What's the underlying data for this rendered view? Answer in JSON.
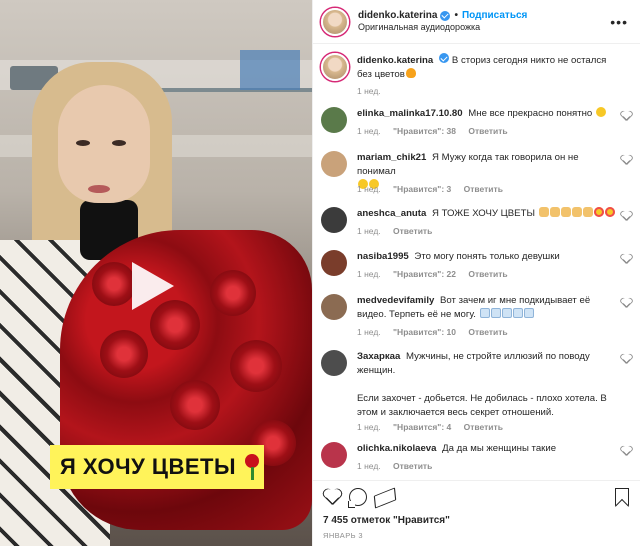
{
  "video": {
    "caption": "Я ХОЧУ ЦВЕТЫ"
  },
  "header": {
    "username": "didenko.katerina",
    "separator": "•",
    "follow_label": "Подписаться",
    "audio": "Оригинальная аудиодорожка",
    "more": "•••"
  },
  "post": {
    "username": "didenko.katerina",
    "text": "В сториз сегодня никто не остался без цветов",
    "time": "1 нед."
  },
  "comments": [
    {
      "user": "elinka_malinka17.10.80",
      "text": "Мне все прекрасно понятно",
      "time": "1 нед.",
      "likes": "\"Нравится\": 38",
      "reply": "Ответить"
    },
    {
      "user": "mariam_chik21",
      "text": "Я Мужу когда так говорила он не понимал",
      "time": "1 нед.",
      "likes": "\"Нравится\": 3",
      "reply": "Ответить"
    },
    {
      "user": "aneshca_anuta",
      "text": "Я ТОЖЕ ХОЧУ ЦВЕТЫ",
      "time": "1 нед.",
      "likes": "",
      "reply": "Ответить"
    },
    {
      "user": "nasiba1995",
      "text": "Это могу понять только девушки",
      "time": "1 нед.",
      "likes": "\"Нравится\": 22",
      "reply": "Ответить"
    },
    {
      "user": "medvedevifamily",
      "text": "Вот зачем иг мне подкидывает её видео. Терпеть её не могу.",
      "time": "1 нед.",
      "likes": "\"Нравится\": 10",
      "reply": "Ответить"
    },
    {
      "user": "Захаркаа",
      "text": "Мужчины, не стройте иллюзий по поводу женщин.",
      "text2": "Если захочет - добьется. Не добилась - плохо хотела. В этом и заключается весь секрет отношений.",
      "time": "1 нед.",
      "likes": "\"Нравится\": 4",
      "reply": "Ответить"
    },
    {
      "user": "olichka.nikolaeva",
      "text": "Да да мы женщины такие",
      "time": "1 нед.",
      "likes": "",
      "reply": "Ответить"
    }
  ],
  "footer": {
    "likes": "7 455 отметок \"Нравится\"",
    "date": "ЯНВАРЬ 3"
  }
}
